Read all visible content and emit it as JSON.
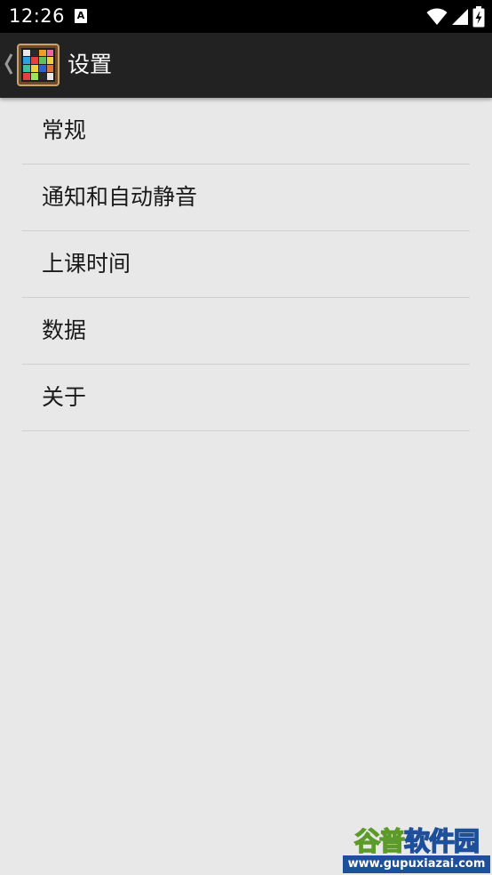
{
  "status_bar": {
    "time": "12:26",
    "notification_glyph": "A",
    "icons": [
      "wifi-icon",
      "cell-signal-icon",
      "battery-charging-icon"
    ]
  },
  "action_bar": {
    "title": "设置",
    "back_icon": "chevron-left-icon",
    "app_icon": "app-grid-icon"
  },
  "settings_list": {
    "items": [
      {
        "label": "常规"
      },
      {
        "label": "通知和自动静音"
      },
      {
        "label": "上课时间"
      },
      {
        "label": "数据"
      },
      {
        "label": "关于"
      }
    ]
  },
  "watermark": {
    "brand_part1": "谷普",
    "brand_part2": "软件园",
    "url": "www.gupuxiazai.com",
    "colors": {
      "green": "#5c9b2a",
      "blue": "#1d4f9a"
    }
  },
  "colors": {
    "status_bar_bg": "#000000",
    "action_bar_bg": "#222222",
    "page_bg": "#e8e8e8",
    "divider": "#cfcfcf",
    "text": "#1a1a1a"
  }
}
